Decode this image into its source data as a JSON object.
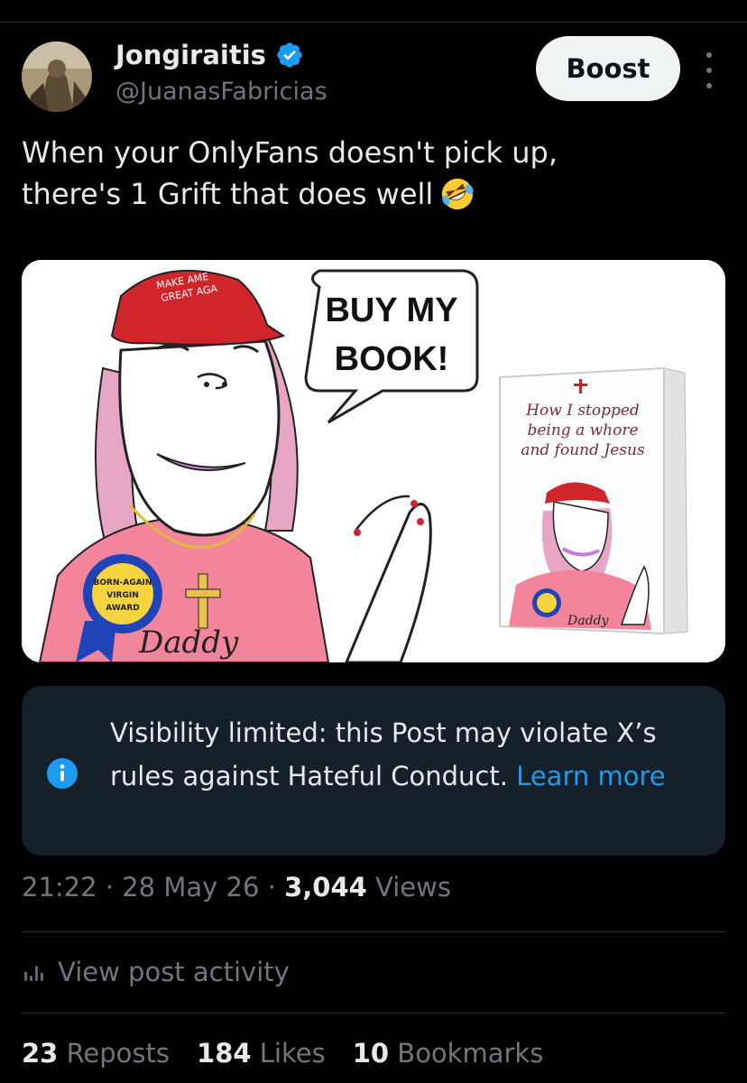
{
  "post": {
    "author_name": "Jongiraitis",
    "author_handle": "@JuanasFabricias",
    "boost_label": "Boost",
    "text_line1": "When your OnlyFans doesn't pick up,",
    "text_line2": "there's 1 Grift that does well",
    "emoji": "rolling-on-floor-laughing-emoji"
  },
  "media": {
    "cap_text_1": "MAKE AME",
    "cap_text_2": "GREAT AGA",
    "speech_line1": "BUY MY",
    "speech_line2": "BOOK!",
    "badge_line1": "BORN-AGAIN",
    "badge_line2": "VIRGIN",
    "badge_line3": "AWARD",
    "shirt_text": "Daddy",
    "book_line1": "How I stopped",
    "book_line2": "being a whore",
    "book_line3": "and found Jesus",
    "book_shirt_text": "Daddy"
  },
  "notice": {
    "text": "Visibility limited: this Post may violate X’s rules against Hateful Conduct. ",
    "link_label": "Learn more"
  },
  "meta": {
    "time": "21:22",
    "date": "28 May 26",
    "views_count": "3,044",
    "views_label": "Views",
    "separator": "·"
  },
  "activity_label": "View post activity",
  "stats": {
    "reposts_count": "23",
    "reposts_label": "Reposts",
    "likes_count": "184",
    "likes_label": "Likes",
    "bookmarks_count": "10",
    "bookmarks_label": "Bookmarks"
  },
  "colors": {
    "background": "#000000",
    "link": "#1d9bf0",
    "verified": "#1d9bf0",
    "notice_bg": "#16202a",
    "muted": "#71767b"
  }
}
